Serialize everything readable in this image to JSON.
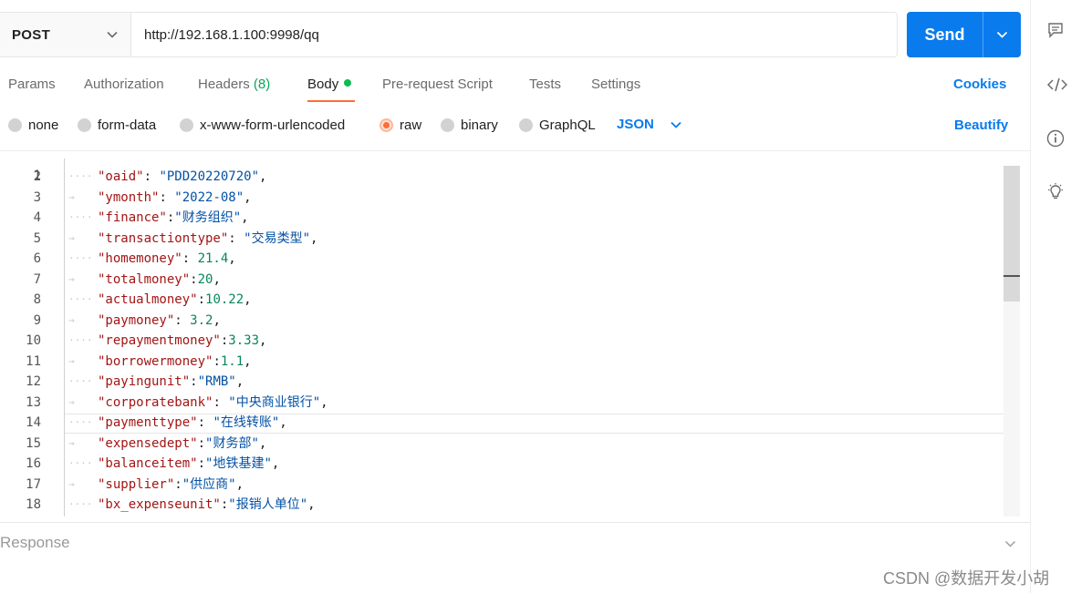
{
  "request": {
    "method": "POST",
    "url": "http://192.168.1.100:9998/qq",
    "send_label": "Send"
  },
  "tabs": {
    "params": "Params",
    "authorization": "Authorization",
    "headers": "Headers",
    "headers_count": "(8)",
    "body": "Body",
    "pre_request": "Pre-request Script",
    "tests": "Tests",
    "settings": "Settings",
    "cookies": "Cookies"
  },
  "body_types": {
    "none": "none",
    "form_data": "form-data",
    "urlencoded": "x-www-form-urlencoded",
    "raw": "raw",
    "binary": "binary",
    "graphql": "GraphQL",
    "selected": "raw",
    "format": "JSON",
    "beautify": "Beautify"
  },
  "editor": {
    "first_line_number": "1",
    "lines": [
      {
        "num": "2",
        "key": "\"oaid\"",
        "sep": ": ",
        "value": "\"PDD20220720\"",
        "type": "s",
        "tail": ","
      },
      {
        "num": "3",
        "key": "\"ymonth\"",
        "sep": ": ",
        "value": "\"2022-08\"",
        "type": "s",
        "tail": ","
      },
      {
        "num": "4",
        "key": "\"finance\"",
        "sep": ":",
        "value": "\"财务组织\"",
        "type": "s",
        "tail": ","
      },
      {
        "num": "5",
        "key": "\"transactiontype\"",
        "sep": ": ",
        "value": "\"交易类型\"",
        "type": "s",
        "tail": ","
      },
      {
        "num": "6",
        "key": "\"homemoney\"",
        "sep": ": ",
        "value": "21.4",
        "type": "n",
        "tail": ","
      },
      {
        "num": "7",
        "key": "\"totalmoney\"",
        "sep": ":",
        "value": "20",
        "type": "n",
        "tail": ","
      },
      {
        "num": "8",
        "key": "\"actualmoney\"",
        "sep": ":",
        "value": "10.22",
        "type": "n",
        "tail": ","
      },
      {
        "num": "9",
        "key": "\"paymoney\"",
        "sep": ": ",
        "value": "3.2",
        "type": "n",
        "tail": ","
      },
      {
        "num": "10",
        "key": "\"repaymentmoney\"",
        "sep": ":",
        "value": "3.33",
        "type": "n",
        "tail": ","
      },
      {
        "num": "11",
        "key": "\"borrowermoney\"",
        "sep": ":",
        "value": "1.1",
        "type": "n",
        "tail": ","
      },
      {
        "num": "12",
        "key": "\"payingunit\"",
        "sep": ":",
        "value": "\"RMB\"",
        "type": "s",
        "tail": ","
      },
      {
        "num": "13",
        "key": "\"corporatebank\"",
        "sep": ": ",
        "value": "\"中央商业银行\"",
        "type": "s",
        "tail": ","
      },
      {
        "num": "14",
        "key": "\"paymenttype\"",
        "sep": ": ",
        "value": "\"在线转账\"",
        "type": "s",
        "tail": ","
      },
      {
        "num": "15",
        "key": "\"expensedept\"",
        "sep": ":",
        "value": "\"财务部\"",
        "type": "s",
        "tail": ","
      },
      {
        "num": "16",
        "key": "\"balanceitem\"",
        "sep": ":",
        "value": "\"地铁基建\"",
        "type": "s",
        "tail": ","
      },
      {
        "num": "17",
        "key": "\"supplier\"",
        "sep": ":",
        "value": "\"供应商\"",
        "type": "s",
        "tail": ","
      },
      {
        "num": "18",
        "key": "\"bx_expenseunit\"",
        "sep": ":",
        "value": "\"报销人单位\"",
        "type": "s",
        "tail": ","
      }
    ]
  },
  "response": {
    "label": "Response"
  },
  "watermark": "CSDN @数据开发小胡",
  "icons": [
    "comment-icon",
    "code-icon",
    "info-icon",
    "lightbulb-icon"
  ],
  "colors": {
    "accent": "#097bed",
    "tab_underline": "#ff6c37",
    "body_dot": "#0cbb52",
    "json_key": "#a31515",
    "json_string": "#0451a5",
    "json_number": "#098658"
  }
}
